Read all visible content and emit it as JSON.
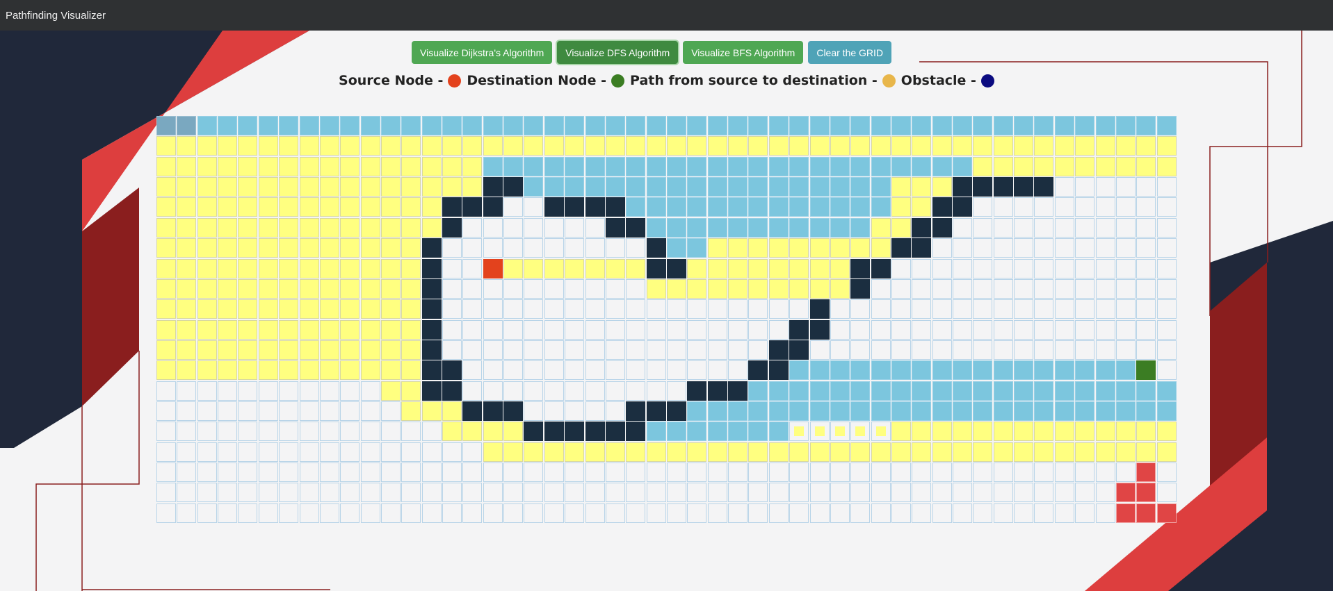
{
  "window": {
    "title": "Pathfinding Visualizer"
  },
  "toolbar": {
    "dijkstra_label": "Visualize Dijkstra's Algorithm",
    "dfs_label": "Visualize DFS Algorithm",
    "bfs_label": "Visualize BFS Algorithm",
    "clear_label": "Clear the GRID"
  },
  "legend": {
    "source_label": "Source Node -",
    "destination_label": "Destination Node -",
    "path_label": "Path from source to destination -",
    "obstacle_label": "Obstacle -"
  },
  "colors": {
    "source": "#e3421d",
    "destination": "#3b7d23",
    "path": "#e8b64a",
    "obstacle": "#0a0a80",
    "visited": "#7cc6de",
    "path_cell": "#ffff80",
    "wall": "#1b2e40"
  },
  "grid": {
    "cols": 50,
    "legend_codes": "v=visited, y=path, w=wall, s=source, d=destination, .=empty, m=small path, g=highlighted, r=red",
    "rows": [
      "ggvvvvvvvvvvvvvvvvvvvvvvvvvvvvvvvvvvvvvvvvvvvvvvvv",
      "yyyyyyyyyyyyyyyyyyyyyyyyyyyyyyyyyyyyyyyyyyyyyyyyyy",
      "yyyyyyyyyyyyyyyyvvvvvvvvvvvvvvvvvvvvvvvvyyyyyyyyyy",
      "yyyyyyyyyyyyyyyywwvvvvvvvvvvvvvvvvvvyyywwwww......",
      "yyyyyyyyyyyyyywww..wwwwvvvvvvvvvvvvvyyww..........",
      "yyyyyyyyyyyyyyw.......wwvvvvvvvvvvvyyww...........",
      "yyyyyyyyyyyyyw..........wvvyyyyyyyyyww............",
      "yyyyyyyyyyyyyw..syyyyyyywwyyyyyyyyww..............",
      "yyyyyyyyyyyyyw..........yyyyyyyyyyw...............",
      "yyyyyyyyyyyyyw..................w.................",
      "yyyyyyyyyyyyyw.................ww.................",
      "yyyyyyyyyyyyyw................ww..................",
      "yyyyyyyyyyyyyww..............wwvvvvvvvvvvvvvvvvvd.",
      "...........yyww...........wwwvvvvvvvvvvvvvvvvvvvvv",
      "............yyywww.....wwwvvvvvvvvvvvvvvvvvvvvvvvv",
      "..............yyyywwwwwwvvvvvvvmmmmmyyyyyyyyyyyyyy",
      "................yyyyyyyyyyyyyyyyyyyyyyyyyyyyyyyyyy",
      "................................................r.",
      "...............................................rr.",
      "...............................................rrr"
    ]
  }
}
